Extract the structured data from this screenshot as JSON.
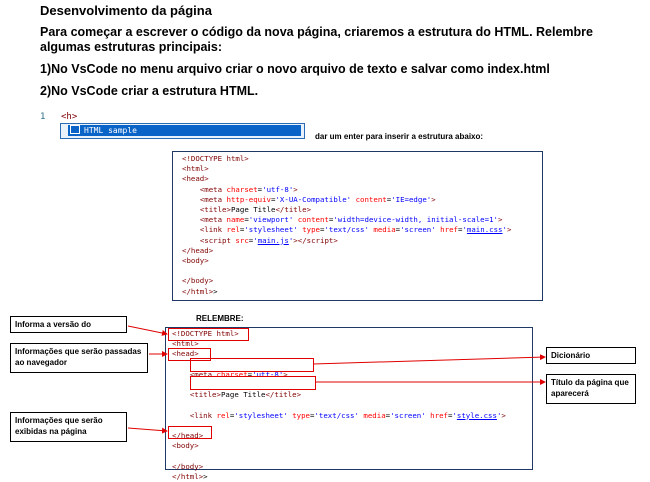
{
  "heading": "Desenvolvimento da página",
  "intro": "Para começar a escrever o código da nova página, criaremos a estrutura do HTML. Relembre algumas estruturas principais:",
  "step1": "1)No VsCode no menu arquivo criar o novo arquivo de texto e salvar como index.html",
  "step2": "2)No VsCode criar a estrutura HTML.",
  "editor": {
    "line_number": "1",
    "typed": "<h>",
    "suggestion": "HTML sample"
  },
  "enter_hint": "dar um enter para inserir a estrutura abaixo:",
  "relembre_label": "RELEMBRE:",
  "annotations": {
    "version": "Informa a versão do",
    "head_info": "Informações que serão passadas ao navegador",
    "dictionary": "Dicionário",
    "page_title": "Título da página que aparecerá",
    "body_info": "Informações que serão exibidas na página"
  },
  "colors": {
    "tag": "#800000",
    "attr": "#ff0000",
    "value": "#0000ff",
    "highlight": "#e00000",
    "border": "#1f3864"
  }
}
